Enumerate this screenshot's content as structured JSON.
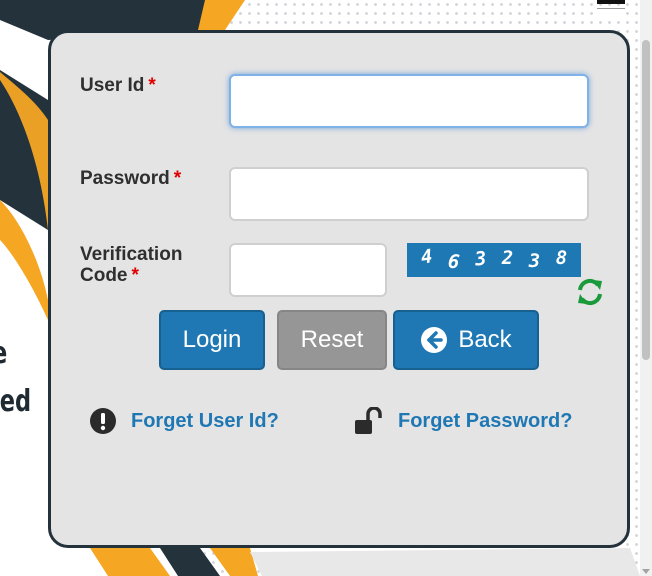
{
  "background": {
    "partial_text_line1": "e",
    "partial_text_line2": "led",
    "colors": {
      "navy": "#24323c",
      "orange": "#f5a623"
    }
  },
  "form": {
    "user_id": {
      "label": "User Id",
      "required_mark": "*",
      "value": ""
    },
    "password": {
      "label": "Password",
      "required_mark": "*",
      "value": ""
    },
    "verification": {
      "label_line1": "Verification",
      "label_line2": "Code",
      "required_mark": "*",
      "value": "",
      "captcha_chars": [
        "4",
        "6",
        "3",
        "2",
        "3",
        "8"
      ]
    }
  },
  "buttons": {
    "login": "Login",
    "reset": "Reset",
    "back": "Back"
  },
  "links": {
    "forget_user_id": "Forget User Id?",
    "forget_password": "Forget Password?"
  },
  "colors": {
    "primary": "#1f78b4",
    "secondary": "#969696",
    "required": "#e00000",
    "refresh_icon": "#1a9a3a"
  },
  "icons": {
    "back": "arrow-circle-left-icon",
    "refresh": "refresh-icon",
    "forget_user_id": "exclamation-circle-icon",
    "forget_password": "unlock-icon"
  }
}
